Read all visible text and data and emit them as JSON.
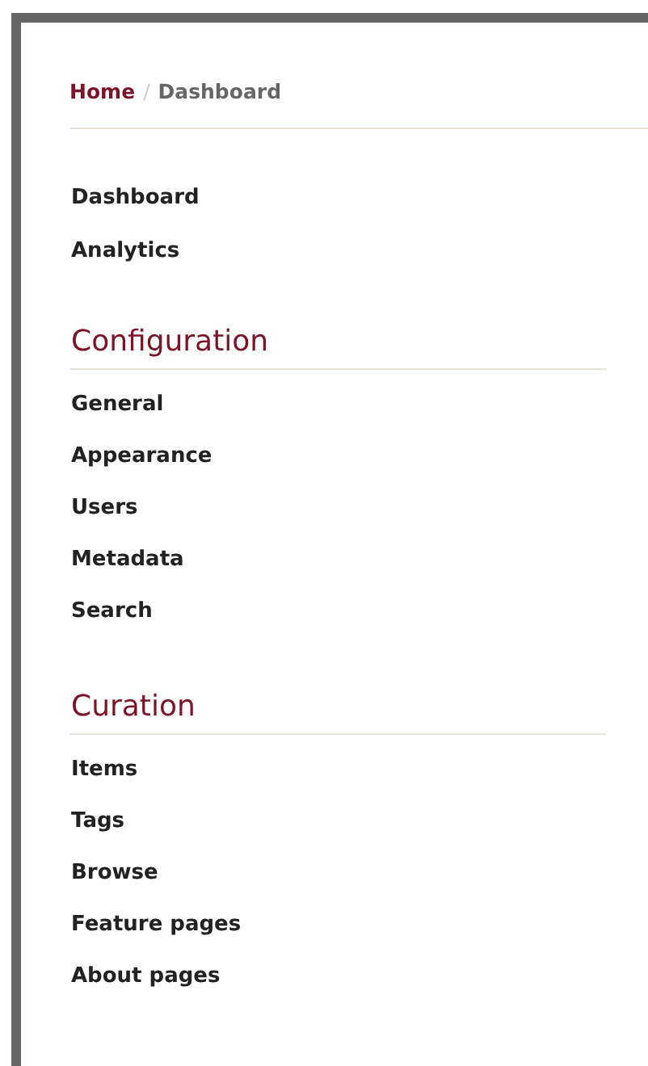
{
  "breadcrumb": [
    {
      "label": "Home",
      "selected": false
    },
    {
      "label": "Dashboard",
      "selected": true
    }
  ],
  "breadcrumb_separator": "/",
  "nav": [
    {
      "label": "Dashboard"
    },
    {
      "label": "Analytics"
    }
  ],
  "sections": [
    {
      "title": "Configuration",
      "items": [
        {
          "label": "General"
        },
        {
          "label": "Appearance"
        },
        {
          "label": "Users"
        },
        {
          "label": "Metadata"
        },
        {
          "label": "Search"
        }
      ]
    },
    {
      "title": "Curation",
      "items": [
        {
          "label": "Items"
        },
        {
          "label": "Tags"
        },
        {
          "label": "Browse"
        },
        {
          "label": "Feature pages"
        },
        {
          "label": "About pages"
        }
      ]
    }
  ]
}
